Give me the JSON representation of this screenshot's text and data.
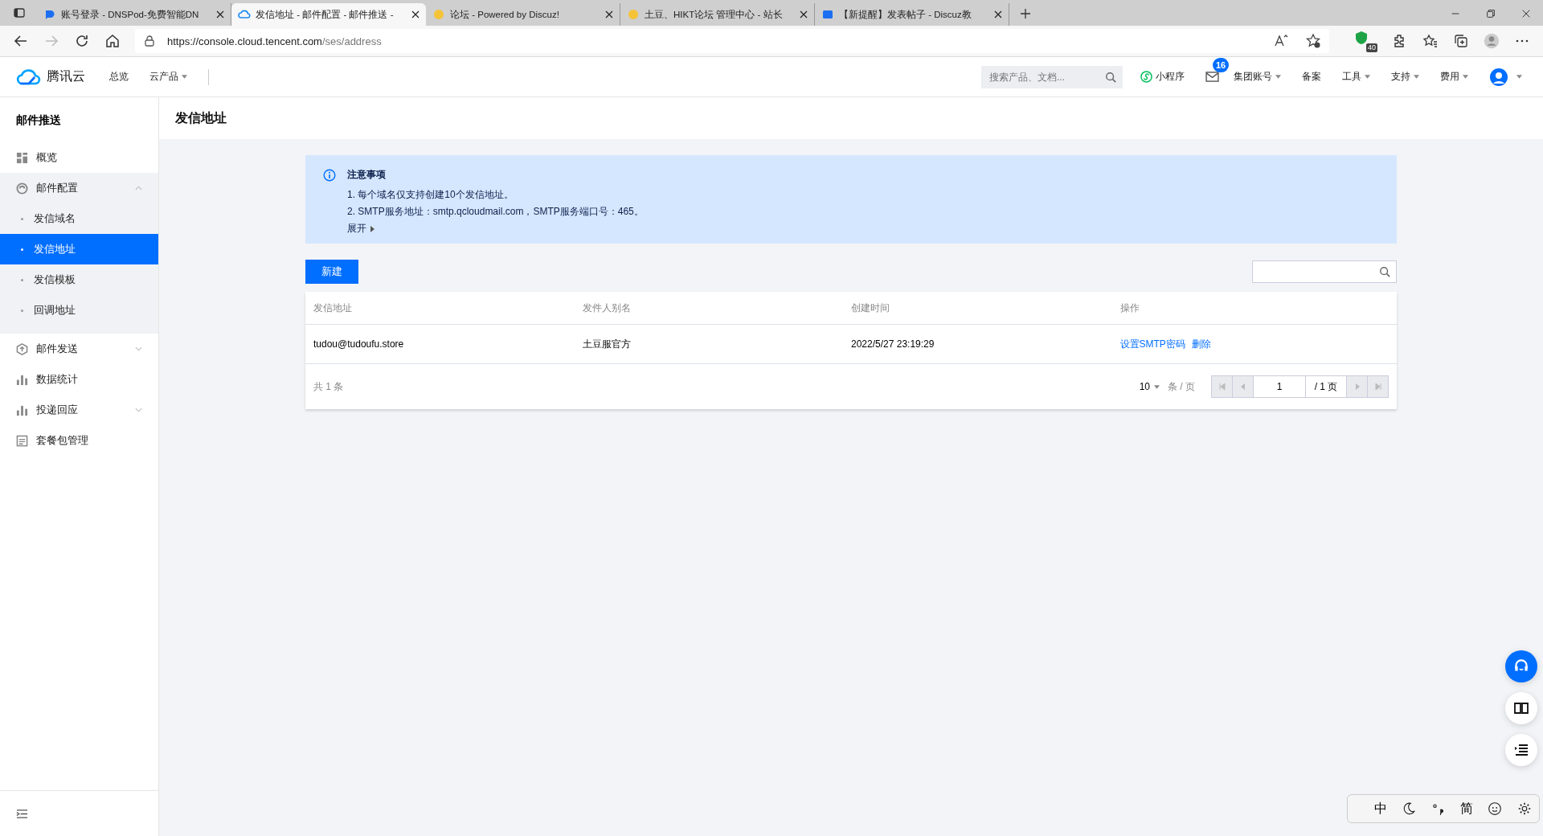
{
  "browser": {
    "tabs": [
      {
        "title": "账号登录 - DNSPod-免费智能DN",
        "selected": false
      },
      {
        "title": "发信地址 - 邮件配置 - 邮件推送 -",
        "selected": true
      },
      {
        "title": "论坛 - Powered by Discuz!",
        "selected": false
      },
      {
        "title": "土豆、HIKT论坛 管理中心 - 站长",
        "selected": false
      },
      {
        "title": "【新提醒】发表帖子 - Discuz教",
        "selected": false
      }
    ],
    "url": {
      "host": "https://console.cloud.tencent.com",
      "path": "/ses/address"
    },
    "extension_badge": "40"
  },
  "header": {
    "logo": "腾讯云",
    "nav": [
      {
        "label": "总览",
        "dropdown": false
      },
      {
        "label": "云产品",
        "dropdown": true
      }
    ],
    "search": {
      "placeholder": "搜索产品、文档..."
    },
    "mini_program": "小程序",
    "mail_badge": "16",
    "menus": [
      {
        "label": "集团账号",
        "dropdown": true
      },
      {
        "label": "备案",
        "dropdown": false
      },
      {
        "label": "工具",
        "dropdown": true
      },
      {
        "label": "支持",
        "dropdown": true
      },
      {
        "label": "费用",
        "dropdown": true
      }
    ]
  },
  "sidebar": {
    "title": "邮件推送",
    "items": [
      {
        "label": "概览",
        "selected": false
      },
      {
        "label": "邮件配置",
        "selected": false,
        "expanded": true,
        "children": [
          {
            "label": "发信域名",
            "selected": false
          },
          {
            "label": "发信地址",
            "selected": true
          },
          {
            "label": "发信模板",
            "selected": false
          },
          {
            "label": "回调地址",
            "selected": false
          }
        ]
      },
      {
        "label": "邮件发送",
        "selected": false,
        "expanded": false
      },
      {
        "label": "数据统计",
        "selected": false
      },
      {
        "label": "投递回应",
        "selected": false,
        "expanded": false
      },
      {
        "label": "套餐包管理",
        "selected": false
      }
    ]
  },
  "page": {
    "title": "发信地址",
    "notice": {
      "title": "注意事项",
      "lines": [
        "1. 每个域名仅支持创建10个发信地址。",
        "2. SMTP服务地址：smtp.qcloudmail.com，SMTP服务端口号：465。"
      ],
      "expand": "展开"
    },
    "new_button": "新建",
    "table": {
      "columns": [
        "发信地址",
        "发件人别名",
        "创建时间",
        "操作"
      ],
      "rows": [
        {
          "address": "tudou@tudoufu.store",
          "alias": "土豆服官方",
          "created": "2022/5/27 23:19:29",
          "actions": [
            "设置SMTP密码",
            "删除"
          ]
        }
      ]
    },
    "pagination": {
      "total": "共 1 条",
      "page_size": "10",
      "per_page": "条 / 页",
      "page": "1",
      "pages": "/ 1 页"
    }
  },
  "ime_toolbar": {
    "mode": "中",
    "script": "简"
  }
}
